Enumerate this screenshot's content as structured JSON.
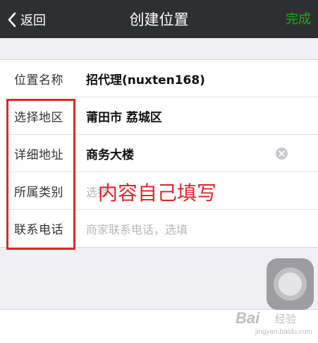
{
  "navbar": {
    "back_label": "返回",
    "title": "创建位置",
    "done_label": "完成"
  },
  "form": {
    "rows": [
      {
        "label": "位置名称",
        "value": "招代理(nuxten168)"
      },
      {
        "label": "选择地区",
        "value": "莆田市 荔城区"
      },
      {
        "label": "详细地址",
        "value": "商务大楼"
      },
      {
        "label": "所属类别",
        "placeholder": "选择"
      },
      {
        "label": "联系电话",
        "placeholder": "商家联系电话，选填"
      }
    ]
  },
  "annotation": {
    "text": "内容自己填写"
  },
  "watermark": {
    "brand": "Bai",
    "sub": "经验",
    "url": "jingyan.baidu.com"
  },
  "colors": {
    "navbar_bg": "#2e2f33",
    "accent_green": "#1aad19",
    "annotation_red": "#e0262c",
    "page_bg": "#efeff4"
  }
}
